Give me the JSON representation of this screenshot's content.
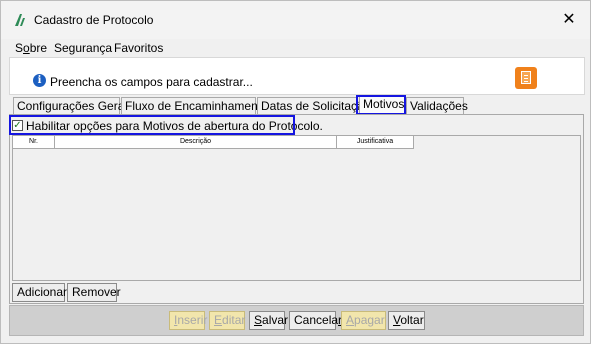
{
  "window": {
    "title": "Cadastro de Protocolo",
    "close_symbol": "✕"
  },
  "menu": [
    {
      "pre": "S",
      "under": "o",
      "post": "bre"
    },
    {
      "pre": "",
      "under": "",
      "post": "Segurança"
    },
    {
      "pre": "",
      "under": "",
      "post": "Favoritos"
    }
  ],
  "info": {
    "icon_symbol": "i",
    "message": "Preencha os campos para cadastrar..."
  },
  "tabs": [
    "Configurações Gerais",
    "Fluxo de Encaminhamentos",
    "Datas de Solicitação",
    "Motivos",
    "Validações"
  ],
  "active_tab": "Motivos",
  "motivos": {
    "enable_checked": true,
    "check_symbol": "✓",
    "enable_label": "Habilitar opções para Motivos de abertura do Protocolo.",
    "columns": [
      "Nr.",
      "Descrição",
      "Justificativa"
    ],
    "rows": [],
    "add_label": "Adicionar",
    "remove_label": "Remover"
  },
  "footer_buttons": [
    {
      "pre": "",
      "under": "I",
      "post": "nserir",
      "enabled": false
    },
    {
      "pre": "",
      "under": "E",
      "post": "ditar",
      "enabled": false
    },
    {
      "pre": "",
      "under": "S",
      "post": "alvar",
      "enabled": true
    },
    {
      "pre": "Cancela",
      "under": "r",
      "post": "",
      "enabled": true
    },
    {
      "pre": "",
      "under": "A",
      "post": "pagar",
      "enabled": false
    },
    {
      "pre": "",
      "under": "V",
      "post": "oltar",
      "enabled": true
    }
  ],
  "colors": {
    "accent_orange": "#f0811b",
    "highlight_blue": "#1515e0",
    "disabled_button": "#f2e6ac",
    "app_icon_green": "#2e8b57"
  }
}
